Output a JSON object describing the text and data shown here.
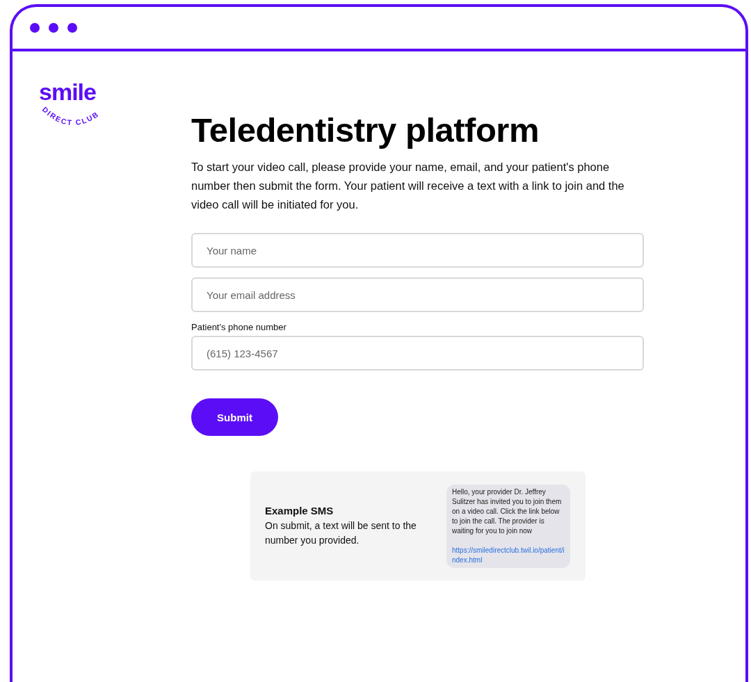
{
  "logo": {
    "wordmark": "smile",
    "tagline": "DIRECT CLUB"
  },
  "title": "Teledentistry platform",
  "intro": "To start your video call, please provide your name, email, and your patient's phone number then submit the form. Your patient will receive a text with a link to join and the video call will be initiated for you.",
  "fields": [
    {
      "placeholder": "Your name"
    },
    {
      "placeholder": "Your email address"
    },
    {
      "label": "Patient's phone number",
      "placeholder": "(615) 123-4567"
    }
  ],
  "submit": "Submit",
  "example": {
    "title": "Example SMS",
    "description": "On submit, a text will be sent to the number you provided.",
    "message": "Hello, your provider Dr. Jeffrey Sulitzer has invited you to join them on a video call. Click the link below to join the call. The provider is waiting for you to join now",
    "link": "https://smiledirectclub.twil.io/patient/index.html"
  }
}
